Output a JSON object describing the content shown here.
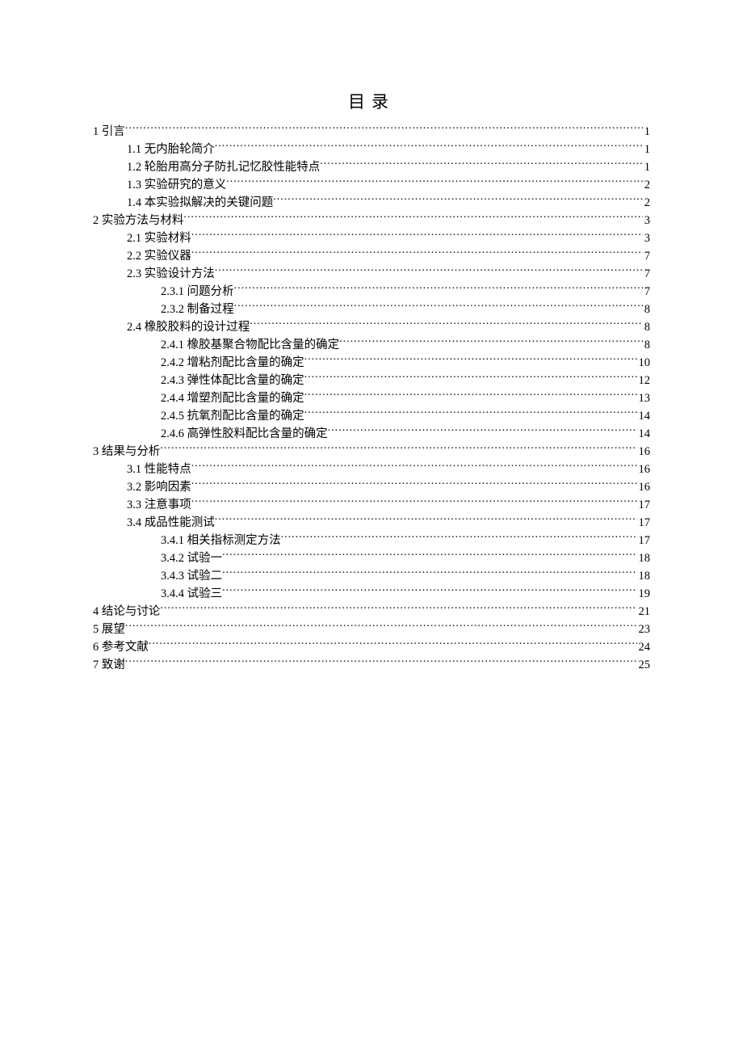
{
  "title": "目录",
  "toc": [
    {
      "level": 1,
      "label": "1 引言",
      "page": "1"
    },
    {
      "level": 2,
      "label": "1.1 无内胎轮简介",
      "page": "1"
    },
    {
      "level": 2,
      "label": "1.2 轮胎用高分子防扎记忆胶性能特点",
      "page": "1"
    },
    {
      "level": 2,
      "label": "1.3 实验研究的意义",
      "page": "2"
    },
    {
      "level": 2,
      "label": "1.4 本实验拟解决的关键问题",
      "page": "2"
    },
    {
      "level": 1,
      "label": "2 实验方法与材料",
      "page": "3"
    },
    {
      "level": 2,
      "label": "2.1 实验材料",
      "page": "3"
    },
    {
      "level": 2,
      "label": "2.2 实验仪器",
      "page": "7"
    },
    {
      "level": 2,
      "label": "2.3 实验设计方法",
      "page": "7"
    },
    {
      "level": 3,
      "label": "2.3.1 问题分析",
      "page": "7"
    },
    {
      "level": 3,
      "label": "2.3.2 制备过程",
      "page": "8"
    },
    {
      "level": 2,
      "label": "2.4 橡胶胶料的设计过程",
      "page": "8"
    },
    {
      "level": 3,
      "label": "2.4.1 橡胶基聚合物配比含量的确定",
      "page": "8"
    },
    {
      "level": 3,
      "label": "2.4.2 增粘剂配比含量的确定",
      "page": "10"
    },
    {
      "level": 3,
      "label": "2.4.3 弹性体配比含量的确定",
      "page": "12"
    },
    {
      "level": 3,
      "label": "2.4.4 增塑剂配比含量的确定",
      "page": "13"
    },
    {
      "level": 3,
      "label": "2.4.5 抗氧剂配比含量的确定",
      "page": "14"
    },
    {
      "level": 3,
      "label": "2.4.6 高弹性胶料配比含量的确定",
      "page": "14"
    },
    {
      "level": 1,
      "label": "3 结果与分析",
      "page": "16"
    },
    {
      "level": 2,
      "label": "3.1 性能特点",
      "page": "16"
    },
    {
      "level": 2,
      "label": "3.2 影响因素",
      "page": "16"
    },
    {
      "level": 2,
      "label": "3.3 注意事项",
      "page": "17"
    },
    {
      "level": 2,
      "label": "3.4 成品性能测试",
      "page": "17"
    },
    {
      "level": 3,
      "label": "3.4.1 相关指标测定方法",
      "page": "17"
    },
    {
      "level": 3,
      "label": "3.4.2 试验一",
      "page": "18"
    },
    {
      "level": 3,
      "label": "3.4.3 试验二",
      "page": "18"
    },
    {
      "level": 3,
      "label": "3.4.4 试验三",
      "page": "19"
    },
    {
      "level": 1,
      "label": "4 结论与讨论",
      "page": "21"
    },
    {
      "level": 1,
      "label": "5 展望",
      "page": "23"
    },
    {
      "level": 1,
      "label": "6 参考文献",
      "page": "24"
    },
    {
      "level": 1,
      "label": "7 致谢",
      "page": "25"
    }
  ]
}
